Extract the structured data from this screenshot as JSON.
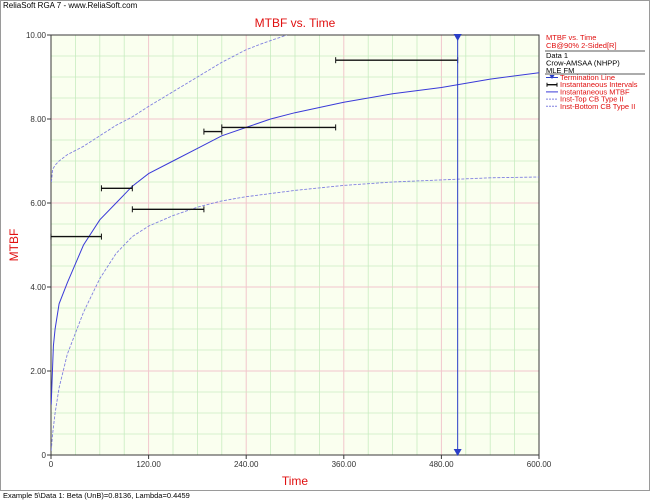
{
  "window": {
    "title": "ReliaSoft RGA 7 - www.ReliaSoft.com",
    "status": "Example 5\\Data 1: Beta (UnB)=0.8136, Lambda=0.4459"
  },
  "colors": {
    "plot_bg": "#faffef",
    "grid_green": "#c8ecc0",
    "grid_pink": "#f2c6cc",
    "axis": "#3a3a3a",
    "red_text": "#e01010",
    "mtbf_line": "#3a3ad8",
    "cb_line": "#8080e0",
    "termination": "#2a3ec8",
    "interval": "#101010"
  },
  "legend": {
    "header": [
      "MTBF vs. Time",
      "CB@90% 2-Sided[R]"
    ],
    "info": [
      "Data 1",
      "Crow-AMSAA (NHPP)",
      "MLE FM"
    ],
    "items": [
      {
        "label": "Termination Line",
        "icon": "triangle-line-icon"
      },
      {
        "label": "Instantaneous Intervals",
        "icon": "interval-bar-icon"
      },
      {
        "label": "Instantaneous MTBF",
        "icon": "line-icon"
      },
      {
        "label": "Inst-Top CB Type II",
        "icon": "dashed-line-icon"
      },
      {
        "label": "Inst-Bottom CB Type II",
        "icon": "dashed-line-icon"
      }
    ]
  },
  "chart_data": {
    "type": "line",
    "title": "MTBF vs. Time",
    "xlabel": "Time",
    "ylabel": "MTBF",
    "xlim": [
      0,
      600
    ],
    "ylim": [
      0,
      10
    ],
    "xticks": [
      "0",
      "120.00",
      "240.00",
      "360.00",
      "480.00",
      "600.00"
    ],
    "yticks": [
      "0",
      "2.00",
      "4.00",
      "6.00",
      "8.00",
      "10.00"
    ],
    "grid": true,
    "termination_time": 500,
    "series": [
      {
        "name": "Instantaneous MTBF",
        "style": "solid",
        "x": [
          0.2,
          1,
          3,
          5,
          10,
          20,
          40,
          60,
          80,
          100,
          120,
          150,
          180,
          210,
          240,
          270,
          300,
          360,
          420,
          480,
          540,
          600
        ],
        "y": [
          1.2,
          1.6,
          2.6,
          3.0,
          3.6,
          4.1,
          5.0,
          5.6,
          6.0,
          6.4,
          6.7,
          7.0,
          7.3,
          7.6,
          7.8,
          8.0,
          8.15,
          8.4,
          8.6,
          8.75,
          8.95,
          9.1
        ]
      },
      {
        "name": "Inst-Top CB Type II",
        "style": "dashed",
        "x": [
          0.5,
          2,
          5,
          10,
          20,
          40,
          60,
          80,
          100,
          120,
          150,
          180,
          210,
          240,
          260,
          290
        ],
        "y": [
          6.5,
          6.8,
          6.9,
          7.0,
          7.15,
          7.35,
          7.6,
          7.85,
          8.05,
          8.3,
          8.65,
          9.0,
          9.35,
          9.65,
          9.8,
          10.0
        ]
      },
      {
        "name": "Inst-Bottom CB Type II",
        "style": "dashed",
        "x": [
          0.2,
          2,
          5,
          10,
          20,
          40,
          60,
          80,
          100,
          120,
          150,
          180,
          210,
          240,
          300,
          360,
          420,
          480,
          540,
          600
        ],
        "y": [
          0.1,
          0.5,
          1.0,
          1.6,
          2.4,
          3.4,
          4.2,
          4.8,
          5.2,
          5.45,
          5.7,
          5.9,
          6.05,
          6.15,
          6.3,
          6.42,
          6.5,
          6.55,
          6.6,
          6.62
        ]
      }
    ],
    "instantaneous_intervals": [
      {
        "start": 0,
        "end": 62,
        "mtbf": 5.2
      },
      {
        "start": 62,
        "end": 100,
        "mtbf": 6.35
      },
      {
        "start": 100,
        "end": 188,
        "mtbf": 5.85
      },
      {
        "start": 188,
        "end": 210,
        "mtbf": 7.7
      },
      {
        "start": 210,
        "end": 350,
        "mtbf": 7.8
      },
      {
        "start": 350,
        "end": 500,
        "mtbf": 9.4
      }
    ]
  }
}
